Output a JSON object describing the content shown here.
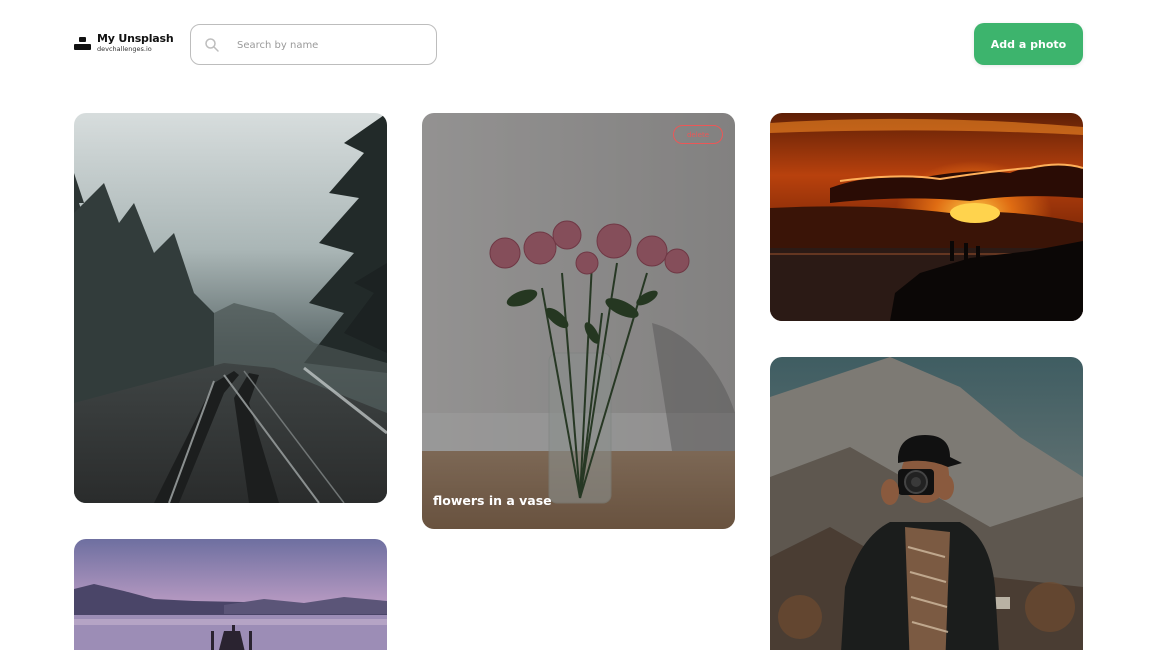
{
  "header": {
    "logo_title": "My Unsplash",
    "logo_subtitle": "devchallenges.io",
    "search_placeholder": "Search by name",
    "search_value": "",
    "add_button_label": "Add a photo"
  },
  "gallery": {
    "hovered_photo": {
      "label": "flowers in a vase",
      "delete_label": "delete"
    },
    "photos": [
      {
        "subject": "foggy forest railway"
      },
      {
        "subject": "flowers in a vase"
      },
      {
        "subject": "sunset over sea cliff"
      },
      {
        "subject": "photographer in mountains"
      },
      {
        "subject": "lake pier at dusk"
      }
    ]
  },
  "colors": {
    "accent": "#3db46d",
    "delete": "#eb5757",
    "border": "#bdbdbd",
    "placeholder": "#9a9a9a"
  },
  "icons": {
    "logo": "user-icon",
    "search": "search-icon"
  }
}
